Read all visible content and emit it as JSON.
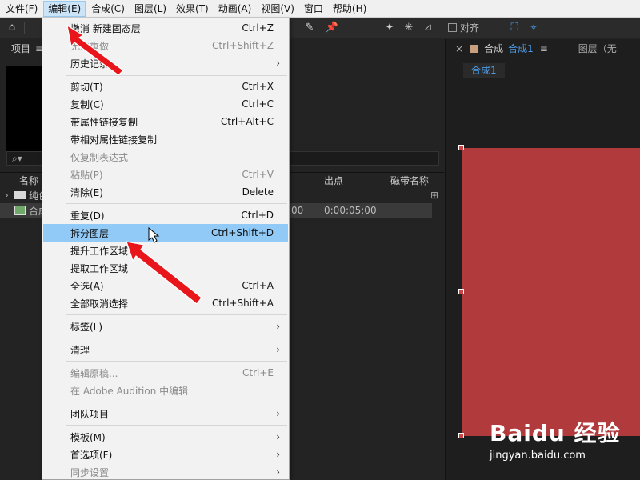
{
  "menubar": {
    "items": [
      {
        "label": "文件(F)"
      },
      {
        "label": "编辑(E)"
      },
      {
        "label": "合成(C)"
      },
      {
        "label": "图层(L)"
      },
      {
        "label": "效果(T)"
      },
      {
        "label": "动画(A)"
      },
      {
        "label": "视图(V)"
      },
      {
        "label": "窗口"
      },
      {
        "label": "帮助(H)"
      }
    ]
  },
  "toolbar": {
    "snap_label": "对齐"
  },
  "project": {
    "title": "项目",
    "search_placeholder": "",
    "columns": {
      "name": "名称",
      "out": "出点",
      "tape": "磁带名称"
    },
    "rows": [
      {
        "name": "纯色",
        "time_in": "",
        "time_out": ""
      },
      {
        "name": "合成",
        "time_in": "00",
        "time_out": "0:00:05:00"
      }
    ]
  },
  "comp": {
    "tab_label": "合成",
    "tab_name": "合成1",
    "layer_tab": "图层（无",
    "subtab": "合成1",
    "solid_color": "#b03a3c"
  },
  "edit_menu": {
    "items": [
      {
        "label": "撤消 新建固态层",
        "shortcut": "Ctrl+Z",
        "disabled": false
      },
      {
        "label": "无法重做",
        "shortcut": "Ctrl+Shift+Z",
        "disabled": true
      },
      {
        "label": "历史记录",
        "shortcut": "",
        "submenu": true
      },
      {
        "label": "剪切(T)",
        "shortcut": "Ctrl+X"
      },
      {
        "label": "复制(C)",
        "shortcut": "Ctrl+C"
      },
      {
        "label": "带属性链接复制",
        "shortcut": "Ctrl+Alt+C"
      },
      {
        "label": "带相对属性链接复制",
        "shortcut": ""
      },
      {
        "label": "仅复制表达式",
        "shortcut": "",
        "disabled": true
      },
      {
        "label": "粘贴(P)",
        "shortcut": "Ctrl+V",
        "disabled": true
      },
      {
        "label": "清除(E)",
        "shortcut": "Delete"
      },
      {
        "label": "重复(D)",
        "shortcut": "Ctrl+D"
      },
      {
        "label": "拆分图层",
        "shortcut": "Ctrl+Shift+D",
        "highlighted": true
      },
      {
        "label": "提升工作区域",
        "shortcut": ""
      },
      {
        "label": "提取工作区域",
        "shortcut": ""
      },
      {
        "label": "全选(A)",
        "shortcut": "Ctrl+A"
      },
      {
        "label": "全部取消选择",
        "shortcut": "Ctrl+Shift+A"
      },
      {
        "label": "标签(L)",
        "shortcut": "",
        "submenu": true
      },
      {
        "label": "清理",
        "shortcut": "",
        "submenu": true
      },
      {
        "label": "编辑原稿...",
        "shortcut": "Ctrl+E",
        "disabled": true
      },
      {
        "label": "在 Adobe Audition 中编辑",
        "shortcut": "",
        "disabled": true
      },
      {
        "label": "团队项目",
        "shortcut": "",
        "submenu": true
      },
      {
        "label": "模板(M)",
        "shortcut": "",
        "submenu": true
      },
      {
        "label": "首选项(F)",
        "shortcut": "",
        "submenu": true
      },
      {
        "label": "同步设置",
        "shortcut": "",
        "submenu": true,
        "disabled": true
      }
    ]
  },
  "watermark": {
    "brand": "Baidu 经验",
    "url": "jingyan.baidu.com"
  }
}
